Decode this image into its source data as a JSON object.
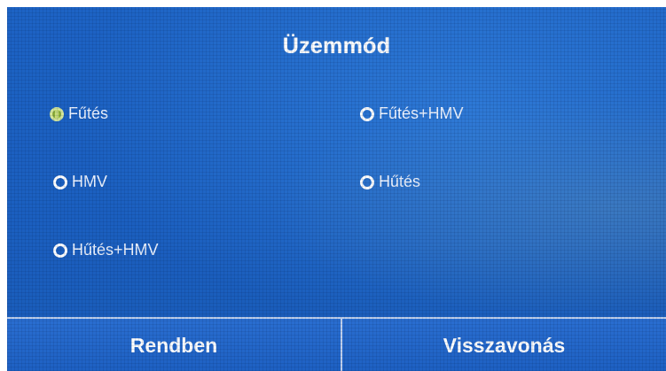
{
  "dialog": {
    "title": "Üzemmód"
  },
  "options": [
    {
      "label": "Fűtés",
      "selected": true
    },
    {
      "label": "Fűtés+HMV",
      "selected": false
    },
    {
      "label": "HMV",
      "selected": false
    },
    {
      "label": "Hűtés",
      "selected": false
    },
    {
      "label": "Hűtés+HMV",
      "selected": false
    }
  ],
  "buttons": {
    "ok_label": "Rendben",
    "cancel_label": "Visszavonás"
  },
  "colors": {
    "background": "#1b5fbf",
    "text": "#ffffff",
    "selected_radio": "#8fb03a"
  }
}
